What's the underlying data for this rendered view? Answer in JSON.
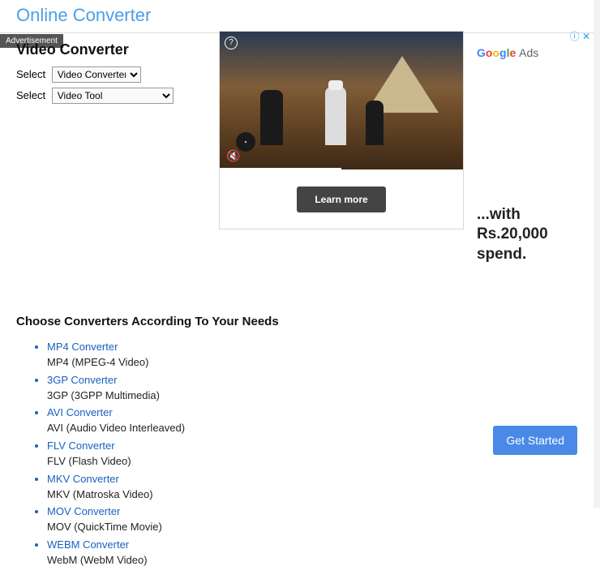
{
  "header": {
    "title": "Online Converter"
  },
  "adLabel": "Advertisement",
  "page": {
    "title": "Video Converter",
    "selectLabel": "Select",
    "converterSelected": "Video Converter",
    "toolSelected": "Video Tool"
  },
  "adBox": {
    "learnMore": "Learn more"
  },
  "sidebar": {
    "googleAds": {
      "g": "G",
      "o1": "o",
      "o2": "o",
      "gg": "g",
      "l": "l",
      "e": "e",
      "ads": " Ads"
    },
    "promo": "...with Rs.20,000 spend.",
    "getStarted": "Get Started",
    "infoGlyph": "ⓘ",
    "closeGlyph": "✕"
  },
  "section": {
    "title": "Choose Converters According To Your Needs"
  },
  "converters": [
    {
      "link": "MP4 Converter",
      "desc": "MP4 (MPEG-4 Video)"
    },
    {
      "link": "3GP Converter",
      "desc": "3GP (3GPP Multimedia)"
    },
    {
      "link": "AVI Converter",
      "desc": "AVI (Audio Video Interleaved)"
    },
    {
      "link": "FLV Converter",
      "desc": "FLV (Flash Video)"
    },
    {
      "link": "MKV Converter",
      "desc": "MKV (Matroska Video)"
    },
    {
      "link": "MOV Converter",
      "desc": "MOV (QuickTime Movie)"
    },
    {
      "link": "WEBM Converter",
      "desc": "WebM (WebM Video)"
    }
  ]
}
